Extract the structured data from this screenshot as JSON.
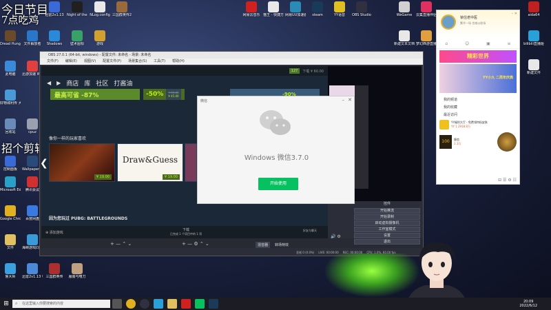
{
  "overlay": {
    "line1": "今日节目",
    "line2": "7点吃鸡",
    "line3": "招个剪辑"
  },
  "desktop_icons_left": [
    {
      "label": "Dread Hunger",
      "color": "#6b4a2a"
    },
    {
      "label": "文件解放者",
      "color": "#2a76c8"
    },
    {
      "label": "Shadows",
      "color": "#2a8ad8"
    },
    {
      "label": "壁术图标",
      "color": "#3aa06a"
    },
    {
      "label": "游戏",
      "color": "#d0a030"
    },
    {
      "label": "此电脑",
      "color": "#3a8ad8"
    },
    {
      "label": "迅游加速 WeGame",
      "color": "#e04040"
    },
    {
      "label": "好物城利传 大之家",
      "color": "#4a9ad8"
    },
    {
      "label": "回收站",
      "color": "#6a8ab8"
    },
    {
      "label": "cpuz",
      "color": "#9aa0b0"
    },
    {
      "label": "控制面板",
      "color": "#3a6ad8"
    },
    {
      "label": "Wallpaper Engine",
      "color": "#2a4a7a"
    },
    {
      "label": "Microsoft Edge",
      "color": "#2aa0c8"
    },
    {
      "label": "腾讯会议",
      "color": "#d03030"
    },
    {
      "label": "Google Chrome",
      "color": "#e0b020"
    },
    {
      "label": "百度网盘",
      "color": "#3a7ae0"
    },
    {
      "label": "文件",
      "color": "#e0c060"
    },
    {
      "label": "海峡游戏同步",
      "color": "#3a9ad8"
    },
    {
      "label": "鲁大师",
      "color": "#3aa0e0"
    },
    {
      "label": "迅雷2v1.13 电视全屏",
      "color": "#4a8ad8"
    }
  ],
  "desktop_icons_top": [
    {
      "label": "迅雷2v1.13",
      "color": "#3a6ad8"
    },
    {
      "label": "Night of the Dead",
      "color": "#202020"
    },
    {
      "label": "NLog.config",
      "color": "#e8e8e8"
    },
    {
      "label": "三国群英传2",
      "color": "#9a6a3a"
    },
    {
      "label": "网易云音乐",
      "color": "#d02020"
    },
    {
      "label": "猫王 - 快捷方式",
      "color": "#e8e8e8"
    },
    {
      "label": "网易UU加速器",
      "color": "#2a8ab8"
    },
    {
      "label": "steam",
      "color": "#1a3a5a"
    },
    {
      "label": "YY语音",
      "color": "#e0c020"
    },
    {
      "label": "OBS Studio",
      "color": "#303040"
    }
  ],
  "desktop_icons_right": [
    {
      "label": "WeGame",
      "color": "#d0d0d0"
    },
    {
      "label": "云集直播伴侣",
      "color": "#e03060"
    },
    {
      "label": "新建文本文档",
      "color": "#e8e8e8"
    },
    {
      "label": "梦幻西游直播",
      "color": "#e0a040"
    },
    {
      "label": "aida64",
      "color": "#c02020"
    },
    {
      "label": "bilibili直播姬",
      "color": "#2aa0d8"
    },
    {
      "label": "新建文件",
      "color": "#e8e8e8"
    }
  ],
  "bottom_icons": [
    {
      "label": "ToDesk",
      "color": "#3a6ae0"
    },
    {
      "label": "TorchLight II",
      "color": "#8a5a2a"
    },
    {
      "label": "三国群英传",
      "color": "#aa3030"
    },
    {
      "label": "服装与嗜刀",
      "color": "#c0a080"
    }
  ],
  "obs": {
    "title": "OBS 27.0.1 (64-bit, windows) - 配置文件: 未命名 - 场景: 未命名",
    "menu": [
      "文件(F)",
      "编辑(E)",
      "视图(V)",
      "配置文件(P)",
      "场景集合(S)",
      "工具(T)",
      "帮助(H)"
    ],
    "controls": [
      "开始推流",
      "开始录制",
      "启动虚拟摄像机",
      "工作室模式",
      "设置",
      "退出"
    ],
    "controls_header": "控件",
    "tabs": [
      "混音器",
      "转场特效"
    ],
    "status": {
      "live": "LIVE: 00:00:00",
      "rec": "REC: 00:00:00",
      "cpu": "CPU: 1.0%, 60.00 fps",
      "drop": "丢帧 0 (0.0%)"
    }
  },
  "steam": {
    "nav": [
      "商店",
      "库",
      "社区",
      "打酱油"
    ],
    "sale_top_left": "最高可省 -87%",
    "discount": "-50%",
    "old_price": "¥ 90.00",
    "new_price": "¥ 45.00",
    "discount_right": "-90%",
    "section_similar": "像你一样的玩家喜欢",
    "cards": [
      {
        "label": "",
        "price": "¥ 19.00",
        "color": "#6a2a1a"
      },
      {
        "label": "Draw&Guess",
        "price": "¥ 19.00",
        "color": "#f0f0f0"
      },
      {
        "label": "",
        "price": "",
        "color": "#7a3a5a"
      }
    ],
    "because_played": "因为您玩过 PUBG: BATTLEGROUNDS",
    "add_game": "添加游戏",
    "download": "下载",
    "download_sub": "已完成 1 个项目中的 1 项",
    "friends": "好友与聊天",
    "top_user": "127",
    "top_status": "下载 ¥ 60.00"
  },
  "wechat": {
    "small_title": "微信",
    "title": "Windows 微信3.7.0",
    "button": "开始使用",
    "accent": "#07c160"
  },
  "yy": {
    "username": "锁住老中医",
    "subtitle": "繁华一场 也难以收场",
    "banner": "精彩世界",
    "banner2": "YY小九 二周年庆典",
    "menu": [
      "我的频道",
      "我的收藏",
      "最近访问"
    ],
    "item1": "YY福利大厅 - 免费领特权皮肤",
    "item1_sub": "YY 1 2918.8万",
    "item2": "猿恋",
    "item2_sub": "2.3万"
  },
  "taskbar": {
    "search_placeholder": "在这里输入你要搜索的内容",
    "time": "20:09",
    "date": "2022/6/12"
  }
}
